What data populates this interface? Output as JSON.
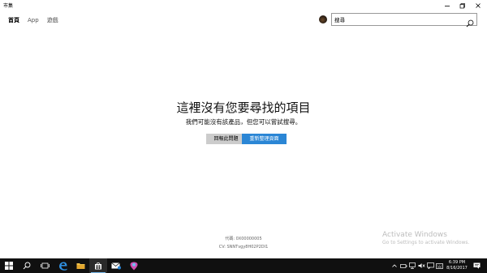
{
  "window": {
    "title": "市集",
    "controls": {
      "minimize": "minimize-icon",
      "maximize": "maximize-icon",
      "close": "close-icon"
    }
  },
  "nav": {
    "items": [
      {
        "label": "首頁",
        "active": true
      },
      {
        "label": "App",
        "active": false
      },
      {
        "label": "遊戲",
        "active": false
      }
    ]
  },
  "search": {
    "placeholder": "搜尋",
    "value": "搜尋",
    "icon": "search-icon"
  },
  "error": {
    "headline": "這裡沒有您要尋找的項目",
    "subline": "我們可能沒有該產品，但您可以嘗試搜尋。",
    "report_button": "回報此問題",
    "reload_button": "重新整理頁面",
    "code": "代碼: 0X00000005",
    "cv": "CV: SNNTvgy8H02P2DI1"
  },
  "watermark": {
    "title": "Activate Windows",
    "subtitle": "Go to Settings to activate Windows."
  },
  "taskbar": {
    "apps": [
      "windows-start-icon",
      "search-icon",
      "task-view-icon",
      "edge-icon",
      "file-explorer-icon",
      "store-icon",
      "mail-icon",
      "app-icon"
    ],
    "clock_time": "6:39 PM",
    "clock_date": "8/16/2017"
  },
  "colors": {
    "accent": "#2b86d5",
    "taskbar": "#101010",
    "report_button": "#cccccc"
  }
}
